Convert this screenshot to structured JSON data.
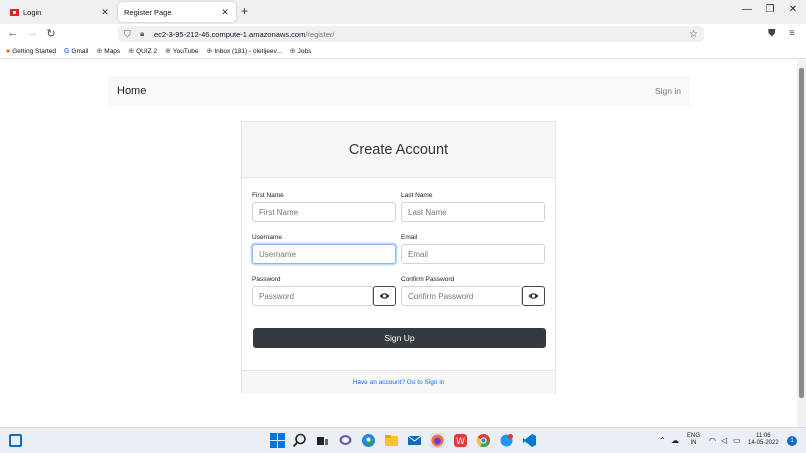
{
  "browser": {
    "tabs": [
      {
        "title": "Login",
        "favicon": "red-flag-icon",
        "active": false
      },
      {
        "title": "Register Page",
        "favicon": "none",
        "active": true
      }
    ],
    "url_host": "ec2-3-95-212-46.compute-1.amazonaws.com",
    "url_path": "/register/",
    "bookmarks": [
      {
        "label": "Getting Started",
        "icon": "firefox-icon"
      },
      {
        "label": "Gmail",
        "icon": "google-icon"
      },
      {
        "label": "Maps",
        "icon": "globe-icon"
      },
      {
        "label": "QUIZ 2",
        "icon": "globe-icon"
      },
      {
        "label": "YouTube",
        "icon": "globe-icon"
      },
      {
        "label": "Inbox (181) - oletijeev...",
        "icon": "globe-icon"
      },
      {
        "label": "Jobs",
        "icon": "globe-icon"
      }
    ]
  },
  "site": {
    "nav_brand": "Home",
    "nav_signin": "Sign in",
    "card_title": "Create Account",
    "fields": {
      "first_name": {
        "label": "First Name",
        "placeholder": "First Name"
      },
      "last_name": {
        "label": "Last Name",
        "placeholder": "Last Name"
      },
      "username": {
        "label": "Username",
        "placeholder": "Username"
      },
      "email": {
        "label": "Email",
        "placeholder": "Email"
      },
      "password": {
        "label": "Password",
        "placeholder": "Password"
      },
      "confirm_password": {
        "label": "Confirm Password",
        "placeholder": "Confirm Password"
      }
    },
    "signup_button": "Sign Up",
    "footer_link": "Have an account? Go to Sign in"
  },
  "taskbar": {
    "language": "ENG",
    "region": "IN",
    "time": "11:06",
    "date": "14-05-2022",
    "notification_count": "1"
  },
  "colors": {
    "accent_link": "#0d6efd",
    "button_dark": "#343a40",
    "focus_border": "#86b7fe"
  }
}
